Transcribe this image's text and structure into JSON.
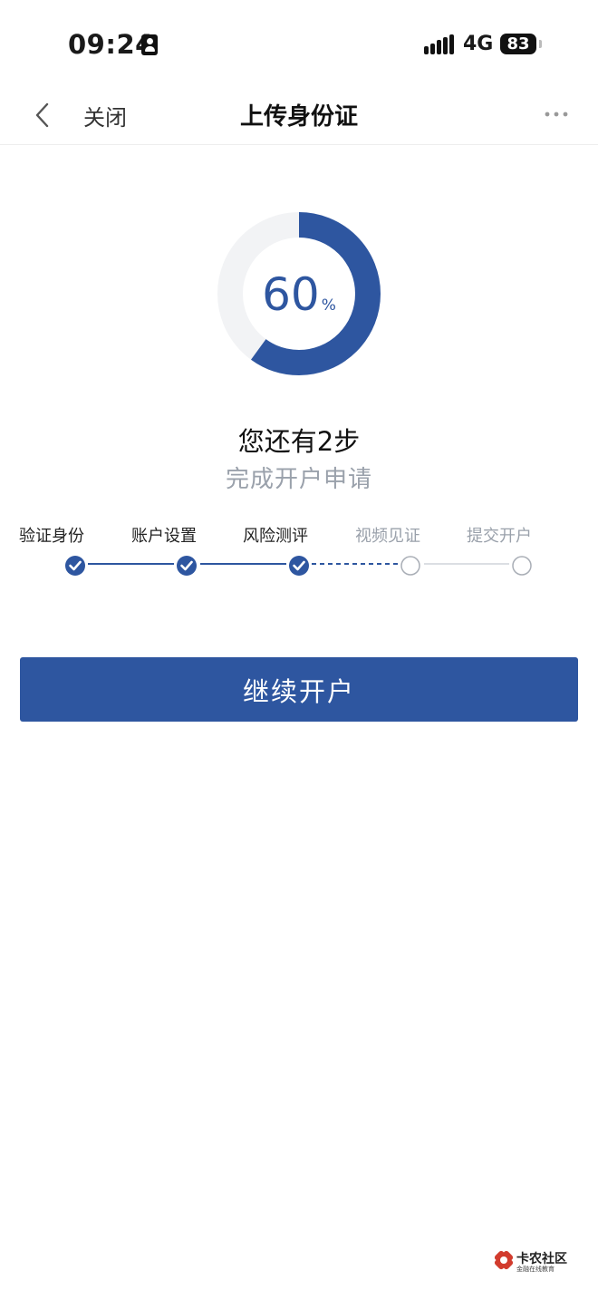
{
  "status_bar": {
    "time": "09:24",
    "network": "4G",
    "battery": "83",
    "person_icon": "person-badge-icon",
    "signal_icon": "signal-bars-icon"
  },
  "nav": {
    "back_icon": "chevron-left-icon",
    "close_label": "关闭",
    "title": "上传身份证",
    "more_icon": "more-dots-icon"
  },
  "progress": {
    "percent": 60,
    "value_label": "60",
    "unit_label": "%",
    "color": "#2e56a0",
    "track_color": "#f2f3f5"
  },
  "summary": {
    "remaining": "您还有2步",
    "subtitle": "完成开户申请"
  },
  "steps": [
    {
      "label": "验证身份",
      "status": "done"
    },
    {
      "label": "账户设置",
      "status": "done"
    },
    {
      "label": "风险测评",
      "status": "done"
    },
    {
      "label": "视频见证",
      "status": "todo"
    },
    {
      "label": "提交开户",
      "status": "todo"
    }
  ],
  "action": {
    "continue_label": "继续开户"
  },
  "watermark": {
    "title": "卡农社区",
    "subtitle": "金融在线教育"
  }
}
